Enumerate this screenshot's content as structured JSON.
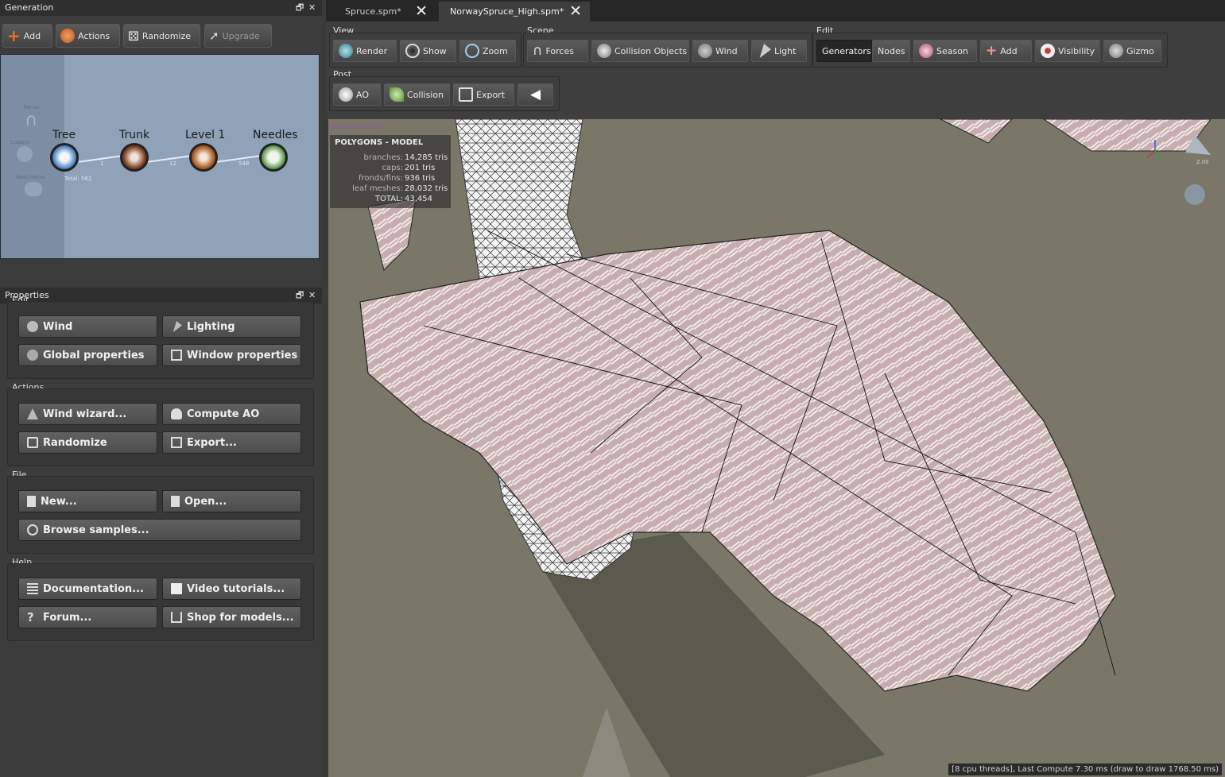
{
  "generation_panel": {
    "title": "Generation",
    "toolbar": {
      "add": "Add",
      "actions": "Actions",
      "randomize": "Randomize",
      "upgrade": "Upgrade"
    },
    "canvas": {
      "side_labels": {
        "forces": "Forces",
        "collision": "Collision",
        "mesh_forces": "Mesh Forces"
      },
      "nodes": [
        {
          "label": "Tree",
          "sub": "Total: 562"
        },
        {
          "label": "Trunk",
          "count": "1"
        },
        {
          "label": "Level 1",
          "count": "12"
        },
        {
          "label": "Needles",
          "count": "548"
        }
      ]
    }
  },
  "properties_panel": {
    "title": "Properties",
    "groups": {
      "edit": {
        "title": "Edit",
        "buttons": [
          "Wind",
          "Lighting",
          "Global properties",
          "Window properties"
        ]
      },
      "actions": {
        "title": "Actions",
        "buttons": [
          "Wind wizard...",
          "Compute AO",
          "Randomize",
          "Export..."
        ]
      },
      "file": {
        "title": "File",
        "buttons": [
          "New...",
          "Open...",
          "Browse samples..."
        ]
      },
      "help": {
        "title": "Help",
        "buttons": [
          "Documentation...",
          "Video tutorials...",
          "Forum...",
          "Shop for models..."
        ]
      }
    }
  },
  "tabs": [
    {
      "label": "Spruce.spm*"
    },
    {
      "label": "NorwaySpruce_High.spm*"
    }
  ],
  "ribbon": {
    "view": {
      "title": "View",
      "buttons": [
        "Render",
        "Show",
        "Zoom"
      ]
    },
    "scene": {
      "title": "Scene",
      "buttons": [
        "Forces",
        "Collision Objects",
        "Wind",
        "Light"
      ]
    },
    "edit": {
      "title": "Edit",
      "buttons": [
        "Generators",
        "Nodes",
        "Season",
        "Add",
        "Visibility",
        "Gizmo"
      ]
    },
    "post": {
      "title": "Post",
      "buttons": [
        "AO",
        "Collision",
        "Export"
      ]
    }
  },
  "viewport": {
    "camera_label": "perspective",
    "stats": {
      "header": "POLYGONS - MODEL",
      "rows": [
        {
          "label": "branches:",
          "value": "14,285 tris"
        },
        {
          "label": "caps:",
          "value": "201 tris"
        },
        {
          "label": "fronds/fins:",
          "value": "936 tris"
        },
        {
          "label": "leaf meshes:",
          "value": "28,032 tris"
        },
        {
          "label": "TOTAL:",
          "value": "43,454"
        }
      ]
    },
    "gizmo_value": "2.00",
    "status": "[8 cpu threads], Last Compute 7.30 ms (draw to draw 1768.50 ms)"
  },
  "colors": {
    "accent_add": "#e8722a",
    "node_tree": "#3d79b8",
    "node_trunk": "#7a3a1e",
    "node_level": "#a8541f",
    "node_needles": "#4f8f3a",
    "ground": "#7a7668",
    "foliage": "#c9b0b0"
  }
}
